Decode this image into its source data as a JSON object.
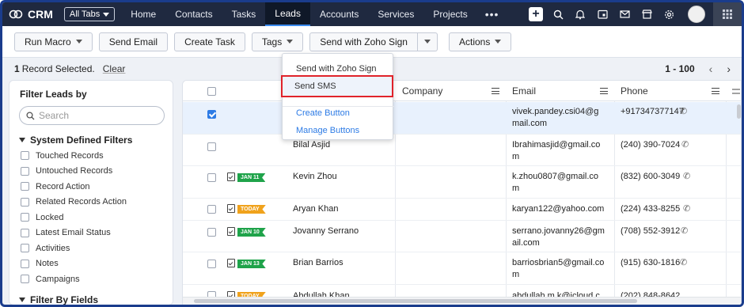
{
  "nav": {
    "logo": "CRM",
    "all_tabs": "All Tabs",
    "tabs": [
      "Home",
      "Contacts",
      "Tasks",
      "Leads",
      "Accounts",
      "Services",
      "Projects"
    ],
    "active_tab": "Leads",
    "more": "•••"
  },
  "toolbar": {
    "run_macro": "Run Macro",
    "send_email": "Send Email",
    "create_task": "Create Task",
    "tags": "Tags",
    "send_zoho_sign": "Send with Zoho Sign",
    "actions": "Actions"
  },
  "selection": {
    "count": "1",
    "text": "Record Selected.",
    "clear": "Clear",
    "range": "1 - 100"
  },
  "filter": {
    "title": "Filter Leads by",
    "search_placeholder": "Search",
    "system_section": "System Defined Filters",
    "system_items": [
      "Touched Records",
      "Untouched Records",
      "Record Action",
      "Related Records Action",
      "Locked",
      "Latest Email Status",
      "Activities",
      "Notes",
      "Campaigns"
    ],
    "fields_section": "Filter By Fields"
  },
  "dropdown": {
    "items": [
      "Send with Zoho Sign",
      "Send SMS",
      "Create Button",
      "Manage Buttons"
    ]
  },
  "table": {
    "columns": [
      "Company",
      "Email",
      "Phone"
    ],
    "rows": [
      {
        "name": "",
        "badge": "",
        "email1": "vivek.pandey.csi04@g",
        "email2": "mail.com",
        "phone": "+917347377147",
        "checked": true
      },
      {
        "name": "Bilal Asjid",
        "badge": "",
        "email1": "Ibrahimasjid@gmail.co",
        "email2": "m",
        "phone": "(240) 390-7024",
        "checked": false
      },
      {
        "name": "Kevin Zhou",
        "badge": "JAN 11",
        "email1": "k.zhou0807@gmail.co",
        "email2": "m",
        "phone": "(832) 600-3049",
        "checked": false
      },
      {
        "name": "Aryan Khan",
        "badge": "TODAY",
        "email1": "karyan122@yahoo.com",
        "email2": "",
        "phone": "(224) 433-8255",
        "checked": false
      },
      {
        "name": "Jovanny Serrano",
        "badge": "JAN 10",
        "email1": "serrano.jovanny26@gm",
        "email2": "ail.com",
        "phone": "(708) 552-3912",
        "checked": false
      },
      {
        "name": "Brian Barrios",
        "badge": "JAN 13",
        "email1": "barriosbrian5@gmail.co",
        "email2": "m",
        "phone": "(915) 630-1816",
        "checked": false
      },
      {
        "name": "Abdullah Khan",
        "badge": "TODAY",
        "email1": "abdullah.m.k@icloud.c",
        "email2": "",
        "phone": "(202) 848-8642",
        "checked": false
      }
    ]
  },
  "colors": {
    "nav_bg": "#1f2940",
    "accent": "#2d7be5",
    "badge_green": "#1fa34a",
    "badge_orange": "#f0a21c",
    "highlight": "#e0232a"
  }
}
